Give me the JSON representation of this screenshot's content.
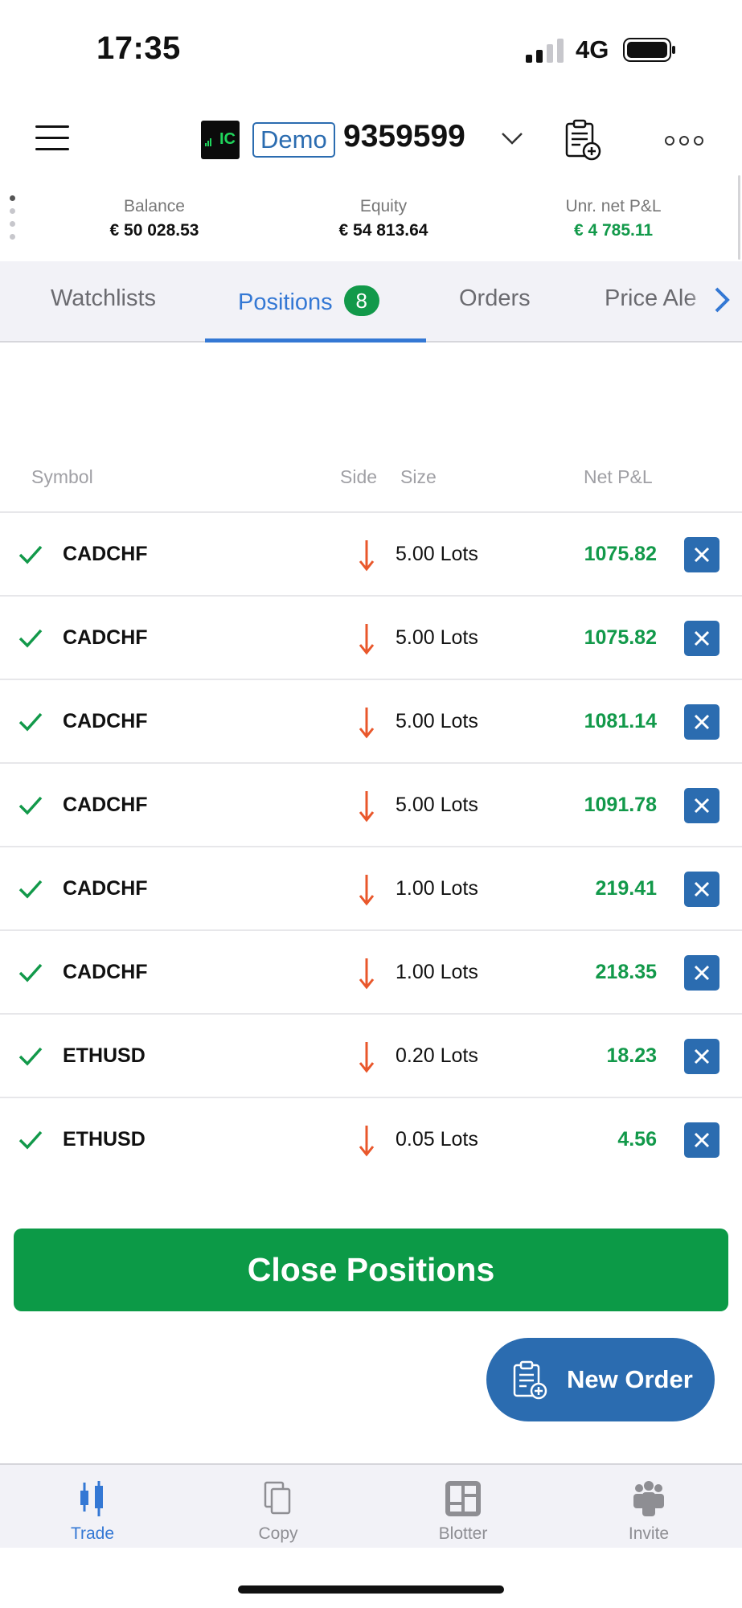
{
  "status_bar": {
    "time": "17:35",
    "network": "4G"
  },
  "header": {
    "logo_text": "IC",
    "demo_label": "Demo",
    "account_number": "9359599"
  },
  "summary": {
    "balance": {
      "label": "Balance",
      "value": "€ 50 028.53"
    },
    "equity": {
      "label": "Equity",
      "value": "€ 54 813.64"
    },
    "unrealized": {
      "label": "Unr. net P&L",
      "value": "€ 4 785.11"
    }
  },
  "tabs": [
    {
      "label": "Watchlists"
    },
    {
      "label": "Positions",
      "count": "8"
    },
    {
      "label": "Orders"
    },
    {
      "label": "Price Ale"
    }
  ],
  "table": {
    "columns": {
      "symbol": "Symbol",
      "side": "Side",
      "size": "Size",
      "pnl": "Net P&L"
    },
    "rows": [
      {
        "symbol": "CADCHF",
        "side": "sell",
        "size": "5.00 Lots",
        "pnl": "1075.82"
      },
      {
        "symbol": "CADCHF",
        "side": "sell",
        "size": "5.00 Lots",
        "pnl": "1075.82"
      },
      {
        "symbol": "CADCHF",
        "side": "sell",
        "size": "5.00 Lots",
        "pnl": "1081.14"
      },
      {
        "symbol": "CADCHF",
        "side": "sell",
        "size": "5.00 Lots",
        "pnl": "1091.78"
      },
      {
        "symbol": "CADCHF",
        "side": "sell",
        "size": "1.00 Lots",
        "pnl": "219.41"
      },
      {
        "symbol": "CADCHF",
        "side": "sell",
        "size": "1.00 Lots",
        "pnl": "218.35"
      },
      {
        "symbol": "ETHUSD",
        "side": "sell",
        "size": "0.20 Lots",
        "pnl": "18.23"
      },
      {
        "symbol": "ETHUSD",
        "side": "sell",
        "size": "0.05 Lots",
        "pnl": "4.56"
      }
    ]
  },
  "buttons": {
    "close_positions": "Close Positions",
    "new_order": "New Order"
  },
  "bottom_nav": [
    {
      "label": "Trade",
      "icon": "candlestick-icon",
      "active": true
    },
    {
      "label": "Copy",
      "icon": "copy-icon",
      "active": false
    },
    {
      "label": "Blotter",
      "icon": "blotter-icon",
      "active": false
    },
    {
      "label": "Invite",
      "icon": "people-icon",
      "active": false
    }
  ],
  "colors": {
    "accent": "#3478d4",
    "positive": "#12994a",
    "sell_arrow": "#e9572b",
    "button_blue": "#2b6cb0",
    "button_green": "#0c9a47"
  }
}
